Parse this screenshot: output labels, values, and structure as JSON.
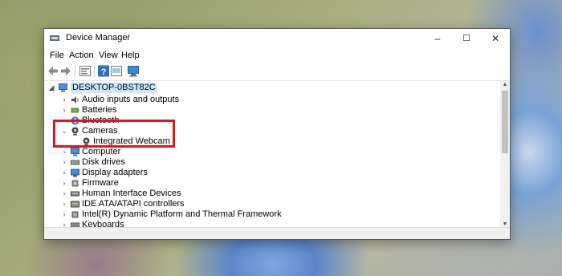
{
  "window": {
    "title": "Device Manager"
  },
  "controls": {
    "minimize": "–",
    "maximize": "☐",
    "close": "✕"
  },
  "menu": [
    "File",
    "Action",
    "View",
    "Help"
  ],
  "toolbar": {
    "icons": [
      "back-icon",
      "forward-icon",
      "properties-icon",
      "help-icon",
      "update-driver-icon",
      "scan-hardware-icon"
    ]
  },
  "tree": {
    "root": "DESKTOP-0BST82C",
    "items": [
      {
        "label": "Audio inputs and outputs",
        "expanded": false,
        "icon": "speaker-icon"
      },
      {
        "label": "Batteries",
        "expanded": false,
        "icon": "battery-icon"
      },
      {
        "label": "Bluetooth",
        "expanded": false,
        "icon": "bluetooth-icon"
      },
      {
        "label": "Cameras",
        "expanded": true,
        "icon": "camera-icon",
        "children": [
          "Integrated Webcam"
        ]
      },
      {
        "label": "Computer",
        "expanded": false,
        "icon": "computer-icon"
      },
      {
        "label": "Disk drives",
        "expanded": false,
        "icon": "disk-icon"
      },
      {
        "label": "Display adapters",
        "expanded": false,
        "icon": "display-icon"
      },
      {
        "label": "Firmware",
        "expanded": false,
        "icon": "firmware-icon"
      },
      {
        "label": "Human Interface Devices",
        "expanded": false,
        "icon": "hid-icon"
      },
      {
        "label": "IDE ATA/ATAPI controllers",
        "expanded": false,
        "icon": "ide-icon"
      },
      {
        "label": "Intel(R) Dynamic Platform and Thermal Framework",
        "expanded": false,
        "icon": "chip-icon"
      },
      {
        "label": "Keyboards",
        "expanded": false,
        "icon": "keyboard-icon"
      }
    ]
  },
  "colors": {
    "highlight": "#e0161c",
    "accent": "#0078d7"
  }
}
